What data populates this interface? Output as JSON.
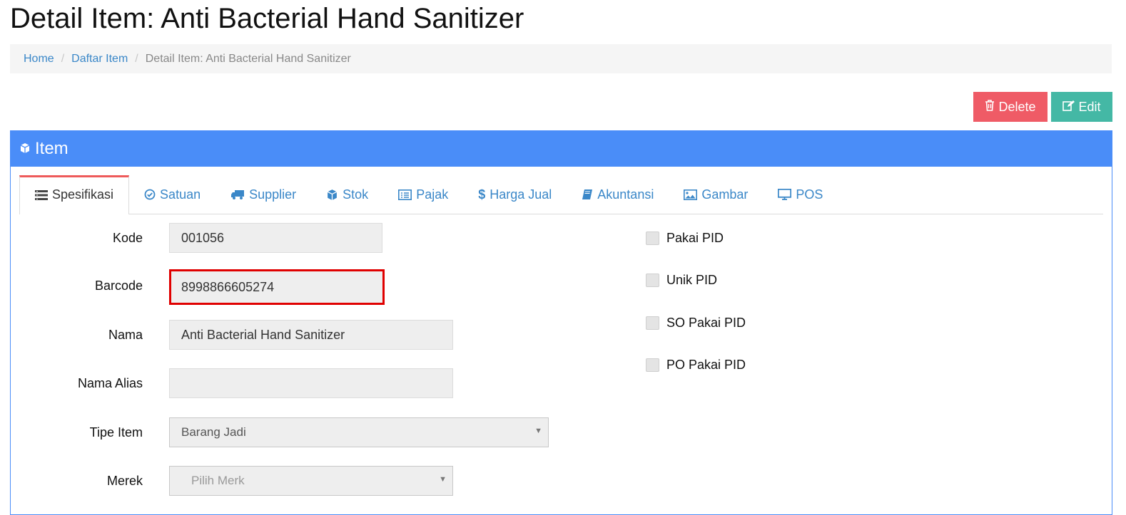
{
  "page": {
    "title": "Detail Item: Anti Bacterial Hand Sanitizer"
  },
  "breadcrumb": {
    "items": [
      {
        "label": "Home"
      },
      {
        "label": "Daftar Item"
      },
      {
        "label": "Detail Item: Anti Bacterial Hand Sanitizer"
      }
    ],
    "separator": "/"
  },
  "actions": {
    "delete_label": "Delete",
    "edit_label": "Edit",
    "delete_color": "#ef5b66",
    "edit_color": "#44b8a5"
  },
  "panel": {
    "title": "Item",
    "icon": "cube-icon",
    "color": "#4a8df8"
  },
  "tabs": [
    {
      "label": "Spesifikasi",
      "icon": "list-icon",
      "active": true
    },
    {
      "label": "Satuan",
      "icon": "check-circle-icon"
    },
    {
      "label": "Supplier",
      "icon": "truck-icon"
    },
    {
      "label": "Stok",
      "icon": "cube-icon"
    },
    {
      "label": "Pajak",
      "icon": "list-alt-icon"
    },
    {
      "label": "Harga Jual",
      "icon": "dollar-icon"
    },
    {
      "label": "Akuntansi",
      "icon": "book-icon"
    },
    {
      "label": "Gambar",
      "icon": "image-icon"
    },
    {
      "label": "POS",
      "icon": "monitor-icon"
    }
  ],
  "form": {
    "kode": {
      "label": "Kode",
      "value": "001056"
    },
    "barcode": {
      "label": "Barcode",
      "value": "8998866605274"
    },
    "nama": {
      "label": "Nama",
      "value": "Anti Bacterial Hand Sanitizer"
    },
    "nama_alias": {
      "label": "Nama Alias",
      "value": ""
    },
    "tipe_item": {
      "label": "Tipe Item",
      "value": "Barang Jadi"
    },
    "merek": {
      "label": "Merek",
      "placeholder": "Pilih Merk"
    }
  },
  "checkboxes": [
    {
      "label": "Pakai PID",
      "checked": false
    },
    {
      "label": "Unik PID",
      "checked": false
    },
    {
      "label": "SO Pakai PID",
      "checked": false
    },
    {
      "label": "PO Pakai PID",
      "checked": false
    }
  ]
}
